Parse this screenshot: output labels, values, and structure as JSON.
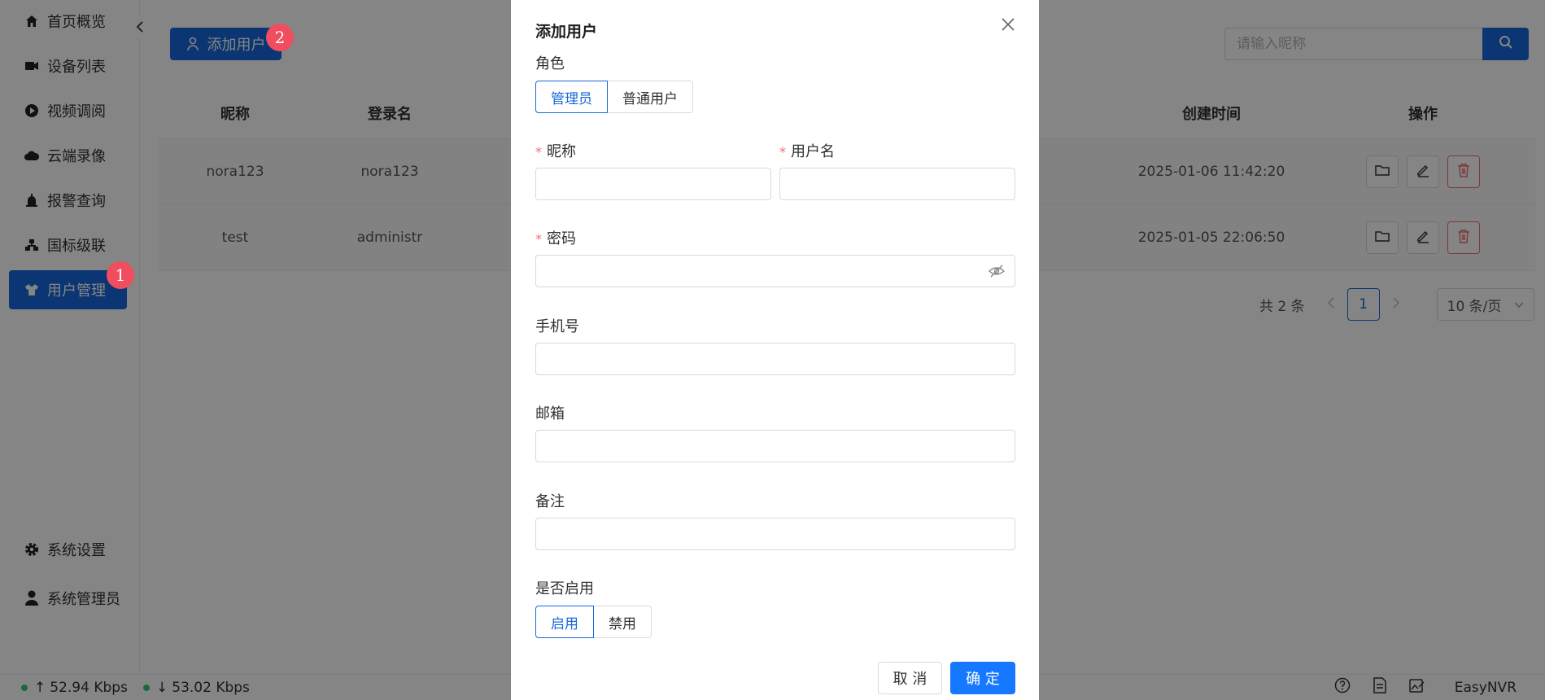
{
  "sidebar": {
    "items": [
      {
        "label": "首页概览",
        "icon": "home-icon"
      },
      {
        "label": "设备列表",
        "icon": "camera-icon"
      },
      {
        "label": "视频调阅",
        "icon": "play-icon"
      },
      {
        "label": "云端录像",
        "icon": "cloud-icon"
      },
      {
        "label": "报警查询",
        "icon": "alarm-icon"
      },
      {
        "label": "国标级联",
        "icon": "cascade-icon"
      },
      {
        "label": "用户管理",
        "icon": "user-shirt-icon"
      }
    ],
    "bottom_items": [
      {
        "label": "系统设置",
        "icon": "gear-icon"
      },
      {
        "label": "系统管理员",
        "icon": "person-icon"
      }
    ],
    "active_index": 6
  },
  "toolbar": {
    "add_user_label": "添加用户",
    "search_placeholder": "请输入昵称"
  },
  "table": {
    "headers": {
      "nickname": "昵称",
      "login": "登录名",
      "created": "创建时间",
      "actions": "操作"
    },
    "rows": [
      {
        "nickname": "nora123",
        "login": "nora123",
        "created": "2025-01-06 11:42:20"
      },
      {
        "nickname": "test",
        "login": "administr",
        "created": "2025-01-05 22:06:50"
      }
    ]
  },
  "pagination": {
    "total": "共 2 条",
    "current_page": "1",
    "page_size": "10 条/页"
  },
  "footer": {
    "upload_rate": "52.94 Kbps",
    "download_rate": "53.02 Kbps",
    "brand": "EasyNVR"
  },
  "badges": {
    "one": "1",
    "two": "2"
  },
  "modal": {
    "title": "添加用户",
    "role_label": "角色",
    "role_options": [
      "管理员",
      "普通用户"
    ],
    "role_selected": "管理员",
    "nickname_label": "昵称",
    "username_label": "用户名",
    "password_label": "密码",
    "phone_label": "手机号",
    "email_label": "邮箱",
    "remark_label": "备注",
    "enabled_label": "是否启用",
    "enabled_options": [
      "启用",
      "禁用"
    ],
    "enabled_selected": "启用",
    "cancel_label": "取 消",
    "ok_label": "确 定",
    "required_mark": "*"
  },
  "colors": {
    "primary": "#1668dc",
    "danger": "#f56c6c",
    "badge": "#f04d5f",
    "online": "#2ecc71"
  }
}
